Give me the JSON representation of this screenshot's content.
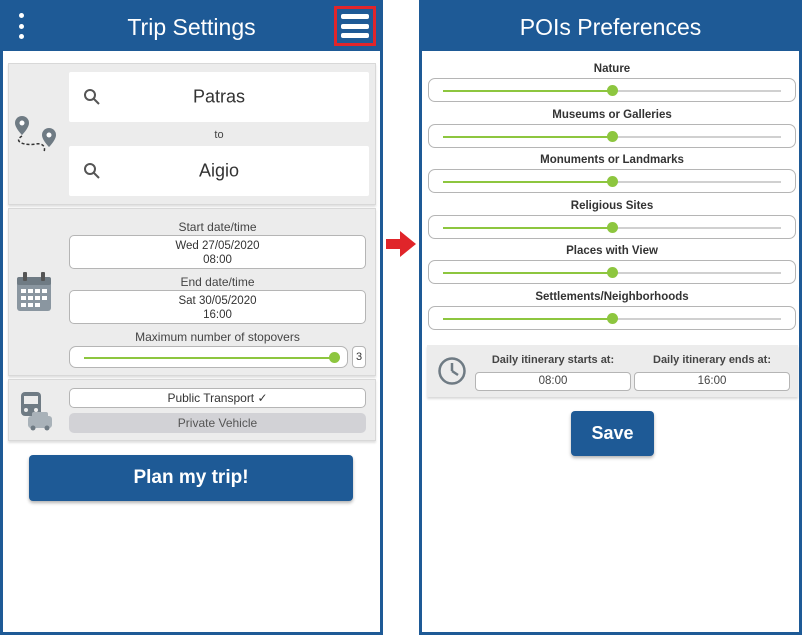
{
  "left_screen": {
    "title": "Trip Settings",
    "origin": "Patras",
    "connector": "to",
    "destination": "Aigio",
    "start_label": "Start date/time",
    "start_date": "Wed 27/05/2020",
    "start_time": "08:00",
    "end_label": "End date/time",
    "end_date": "Sat 30/05/2020",
    "end_time": "16:00",
    "stopovers_label": "Maximum number of stopovers",
    "stopovers_value": "3",
    "transport_public": "Public Transport ✓",
    "transport_private": "Private Vehicle",
    "plan_button": "Plan my trip!"
  },
  "right_screen": {
    "title": "POIs Preferences",
    "preferences": [
      {
        "label": "Nature",
        "level": 0.5
      },
      {
        "label": "Museums or Galleries",
        "level": 0.5
      },
      {
        "label": "Monuments or Landmarks",
        "level": 0.5
      },
      {
        "label": "Religious Sites",
        "level": 0.5
      },
      {
        "label": "Places with View",
        "level": 0.5
      },
      {
        "label": "Settlements/Neighborhoods",
        "level": 0.5
      }
    ],
    "start_label": "Daily itinerary starts at:",
    "start_time": "08:00",
    "end_label": "Daily itinerary ends at:",
    "end_time": "16:00",
    "save_button": "Save"
  },
  "colors": {
    "primary": "#1e5a96",
    "accent": "#8dc63f",
    "highlight": "#e0252a"
  }
}
